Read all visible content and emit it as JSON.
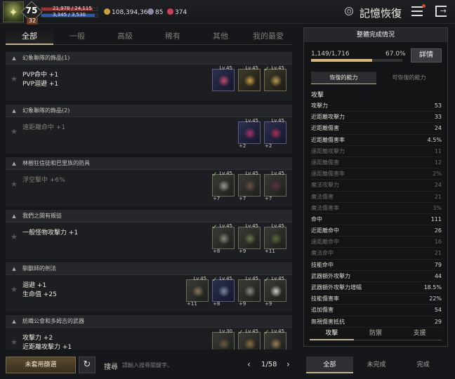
{
  "header": {
    "level": "75",
    "sub_level": "32",
    "hp": "21,978 / 24,115",
    "mp": "3,345 / 3,530",
    "hp_ratio": 0.91,
    "mp_ratio": 0.95,
    "silver": "108,394,366",
    "currency2": "85",
    "currency3": "374",
    "title": "記憶恢復"
  },
  "tabs": [
    "全部",
    "一般",
    "高級",
    "稀有",
    "其他",
    "我的最愛"
  ],
  "groups": [
    {
      "name": "幻象聯隊的飾品(1)",
      "stats": [
        {
          "t": "PVP命中 +1",
          "active": true
        },
        {
          "t": "PVP迴避 +1",
          "active": true
        }
      ],
      "items": [
        {
          "lv": "Lv.45",
          "check": false,
          "plus": "",
          "style": "blue",
          "color": "#c44a6a"
        },
        {
          "lv": "Lv.45",
          "check": false,
          "plus": "",
          "style": "gold",
          "color": "#c9a040"
        },
        {
          "lv": "Lv.45",
          "check": true,
          "plus": "",
          "style": "gold",
          "color": "#b89c50"
        }
      ]
    },
    {
      "name": "幻象聯隊的飾品(2)",
      "stats": [
        {
          "t": "遠距離命中 +1",
          "active": false
        }
      ],
      "items": [
        {
          "lv": "Lv.45",
          "check": false,
          "plus": "+2",
          "style": "blue",
          "color": "#b0306a"
        },
        {
          "lv": "Lv.45",
          "check": false,
          "plus": "+2",
          "style": "blue",
          "color": "#b03050"
        }
      ]
    },
    {
      "name": "林樹狂信徒和巴里族的防具",
      "stats": [
        {
          "t": "浮空擊中 +6%",
          "active": false
        }
      ],
      "items": [
        {
          "lv": "Lv.45",
          "check": true,
          "plus": "+7",
          "style": "on",
          "color": "#9a9a9a"
        },
        {
          "lv": "Lv.45",
          "check": false,
          "plus": "+7",
          "style": "on",
          "color": "#6a5040"
        },
        {
          "lv": "Lv.45",
          "check": false,
          "plus": "+7",
          "style": "on",
          "color": "#5a3040"
        }
      ]
    },
    {
      "name": "我們之間有叛徒",
      "stats": [
        {
          "t": "一般怪物攻擊力 +1",
          "active": true
        }
      ],
      "items": [
        {
          "lv": "Lv.45",
          "check": true,
          "plus": "+8",
          "style": "on",
          "color": "#8a8878"
        },
        {
          "lv": "Lv.45",
          "check": false,
          "plus": "+9",
          "style": "on",
          "color": "#6a7a4a"
        },
        {
          "lv": "Lv.45",
          "check": false,
          "plus": "+11",
          "style": "on",
          "color": "#5a6a3a"
        }
      ]
    },
    {
      "name": "馴獸師的劍法",
      "stats": [
        {
          "t": "迴避 +1",
          "active": true
        },
        {
          "t": "生命值 +25",
          "active": true
        }
      ],
      "items": [
        {
          "lv": "Lv.45",
          "check": false,
          "plus": "+11",
          "style": "on",
          "color": "#8a7a5a"
        },
        {
          "lv": "Lv.45",
          "check": true,
          "plus": "+8",
          "style": "blue",
          "color": "#7a8aa0"
        },
        {
          "lv": "Lv.45",
          "check": false,
          "plus": "+9",
          "style": "on",
          "color": "#8a8a8a"
        },
        {
          "lv": "Lv.45",
          "check": true,
          "plus": "+9",
          "style": "on",
          "color": "#cfcfcf"
        }
      ]
    },
    {
      "name": "紡織公會和多姆吉的武器",
      "stats": [
        {
          "t": "攻擊力 +2",
          "active": true
        },
        {
          "t": "近距離攻擊力 +1",
          "active": true
        }
      ],
      "items": [
        {
          "lv": "Lv.30",
          "check": false,
          "plus": "",
          "style": "on",
          "color": "#6a5a40"
        },
        {
          "lv": "Lv.45",
          "check": true,
          "plus": "",
          "style": "on",
          "color": "#8a7040"
        },
        {
          "lv": "Lv.45",
          "check": true,
          "plus": "",
          "style": "on",
          "color": "#9a8050"
        }
      ]
    }
  ],
  "panel": {
    "title": "整體完成情況",
    "progress": "1,149/1,716",
    "progress_ratio": 0.67,
    "percent": "67.0%",
    "detail_label": "詳情",
    "subtabs": [
      "恢復的能力",
      "可恢復的能力"
    ],
    "category": "攻擊",
    "rows": [
      {
        "k": "攻擊力",
        "v": "53",
        "on": true
      },
      {
        "k": "近距離攻擊力",
        "v": "33",
        "on": true
      },
      {
        "k": "近距離傷害",
        "v": "24",
        "on": true
      },
      {
        "k": "近距離傷害率",
        "v": "4.5%",
        "on": true
      },
      {
        "k": "遠距離攻擊力",
        "v": "11",
        "on": false
      },
      {
        "k": "遠距離傷害",
        "v": "12",
        "on": false
      },
      {
        "k": "遠距離傷害率",
        "v": "2%",
        "on": false
      },
      {
        "k": "魔法攻擊力",
        "v": "24",
        "on": false
      },
      {
        "k": "魔法傷害",
        "v": "21",
        "on": false
      },
      {
        "k": "魔法傷害率",
        "v": "3%",
        "on": false
      },
      {
        "k": "命中",
        "v": "111",
        "on": true
      },
      {
        "k": "近距離命中",
        "v": "26",
        "on": true
      },
      {
        "k": "遠距離命中",
        "v": "16",
        "on": false
      },
      {
        "k": "魔法命中",
        "v": "21",
        "on": false
      },
      {
        "k": "技能命中",
        "v": "79",
        "on": true
      },
      {
        "k": "武器額外攻擊力",
        "v": "44",
        "on": true
      },
      {
        "k": "武器額外攻擊力增幅",
        "v": "18.5%",
        "on": true
      },
      {
        "k": "技能傷害率",
        "v": "22%",
        "on": true
      },
      {
        "k": "追加傷害",
        "v": "54",
        "on": true
      },
      {
        "k": "無視傷害抵抗",
        "v": "29",
        "on": true
      }
    ],
    "bottom_tabs": [
      "攻擊",
      "防禦",
      "支援"
    ]
  },
  "footer": {
    "filter_label": "未套用篩選",
    "search_label": "搜尋",
    "search_placeholder": "請輸入搜尋關鍵字。",
    "page": "1/58",
    "tabs": [
      "全部",
      "未完成",
      "完成"
    ]
  }
}
